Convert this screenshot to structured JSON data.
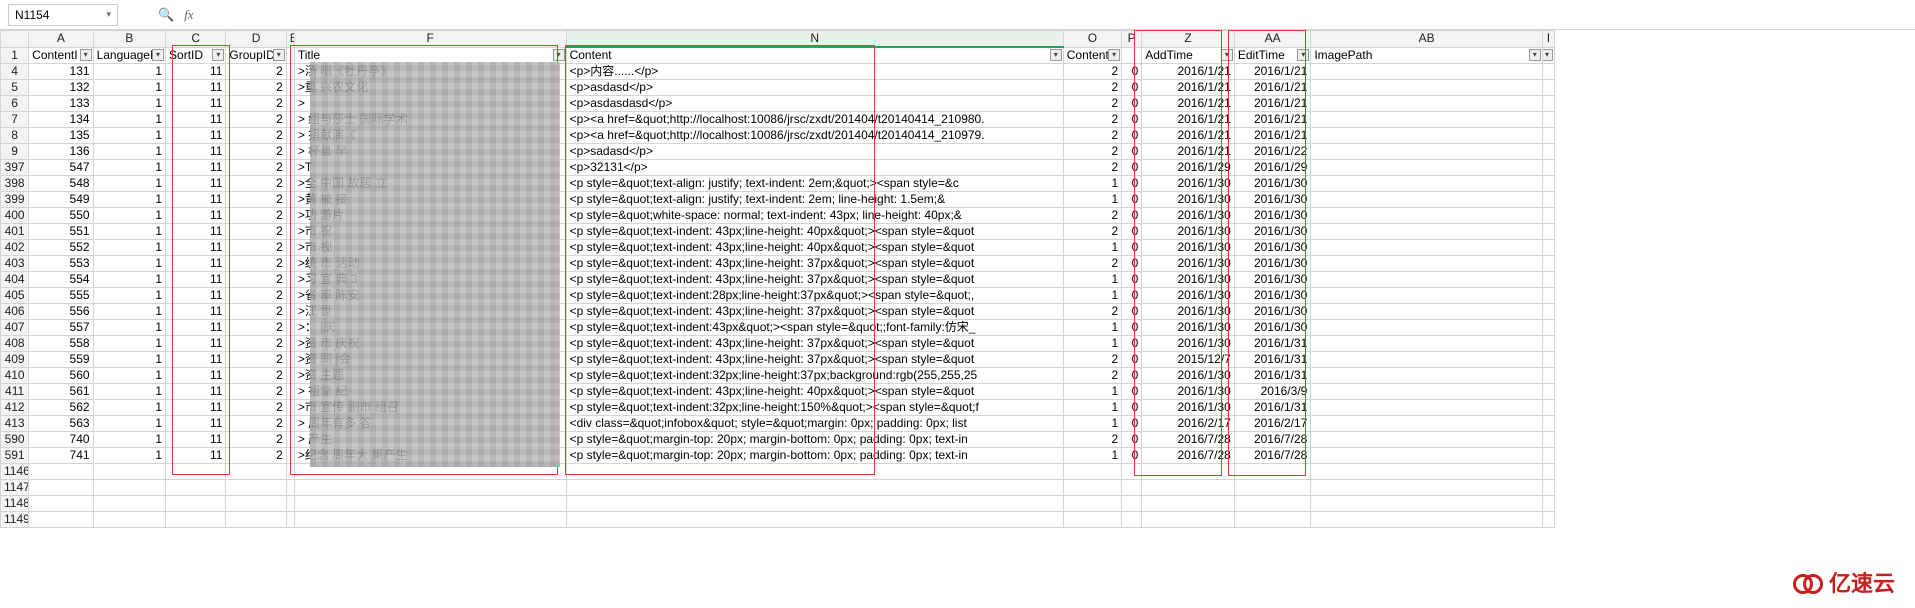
{
  "formula_bar": {
    "name_box": "N1154",
    "fx": "fx",
    "value": ""
  },
  "col_letters": [
    "A",
    "B",
    "C",
    "D",
    "E",
    "F",
    "N",
    "O",
    "P",
    "Z",
    "AA",
    "AB",
    "I"
  ],
  "headers": {
    "A": "ContentI",
    "B": "LanguageI",
    "C": "SortID",
    "D": "GroupID",
    "E": "",
    "F": "Title",
    "N": "Content",
    "O": "Content",
    "P": "",
    "Z": "AddTime",
    "AA": "EditTime",
    "AB": "ImagePath",
    "I": "I"
  },
  "rows": [
    {
      "r": 4,
      "A": 131,
      "B": 1,
      "C": 11,
      "D": 2,
      "F": ">汤           唱《牡丹亭》",
      "N": "<p>内容......</p>",
      "O": 2,
      "P": 0,
      "Z": "2016/1/21",
      "AA": "2016/1/21"
    },
    {
      "r": 5,
      "A": 132,
      "B": 1,
      "C": 11,
      "D": 2,
      "F": ">重             兴农文化",
      "N": "<p>asdasd</p>",
      "O": 2,
      "P": 0,
      "Z": "2016/1/21",
      "AA": "2016/1/21"
    },
    {
      "r": 6,
      "A": 133,
      "B": 1,
      "C": 11,
      "D": 2,
      "F": ">",
      "N": "<p>asdasdasd</p>",
      "O": 2,
      "P": 0,
      "Z": "2016/1/21",
      "AA": "2016/1/21"
    },
    {
      "r": 7,
      "A": 134,
      "B": 1,
      "C": 11,
      "D": 2,
      "F": ">   组与莎士     国际学术",
      "N": "<p><a href=&quot;http://localhost:10086/jrsc/zxdt/201404/t20140414_210980.",
      "O": 2,
      "P": 0,
      "Z": "2016/1/21",
      "AA": "2016/1/21"
    },
    {
      "r": 8,
      "A": 135,
      "B": 1,
      "C": 11,
      "D": 2,
      "F": ">      捐献演《",
      "N": "<p><a href=&quot;http://localhost:10086/jrsc/zxdt/201404/t20140414_210979.",
      "O": 2,
      "P": 0,
      "Z": "2016/1/21",
      "AA": "2016/1/21"
    },
    {
      "r": 9,
      "A": 136,
      "B": 1,
      "C": 11,
      "D": 2,
      "F": ">    杯县         早",
      "N": "<p>sadasd</p>",
      "O": 2,
      "P": 0,
      "Z": "2016/1/21",
      "AA": "2016/1/22"
    },
    {
      "r": 397,
      "A": 547,
      "B": 1,
      "C": 11,
      "D": 2,
      "F": ">T",
      "N": "<p>32131</p>",
      "O": 2,
      "P": 0,
      "Z": "2016/1/29",
      "AA": "2016/1/29"
    },
    {
      "r": 398,
      "A": 548,
      "B": 1,
      "C": 11,
      "D": 2,
      "F": ">全    中国         故居  立",
      "N": "<p style=&quot;text-align: justify; text-indent: 2em;&quot;><span style=&c",
      "O": 1,
      "P": 0,
      "Z": "2016/1/30",
      "AA": "2016/1/30"
    },
    {
      "r": 399,
      "A": 549,
      "B": 1,
      "C": 11,
      "D": 2,
      "F": ">黄     被              接",
      "N": "<p style=&quot;text-align: justify; text-indent: 2em; line-height: 1.5em;&",
      "O": 1,
      "P": 0,
      "Z": "2016/1/30",
      "AA": "2016/1/30"
    },
    {
      "r": 400,
      "A": 550,
      "B": 1,
      "C": 11,
      "D": 2,
      "F": ">功     游片",
      "N": "<p style=&quot;white-space: normal; text-indent: 43px; line-height: 40px;&",
      "O": 2,
      "P": 0,
      "Z": "2016/1/30",
      "AA": "2016/1/30"
    },
    {
      "r": 401,
      "A": 551,
      "B": 1,
      "C": 11,
      "D": 2,
      "F": ">市            祝",
      "N": "<p style=&quot;text-indent: 43px;line-height: 40px&quot;><span style=&quot",
      "O": 2,
      "P": 0,
      "Z": "2016/1/30",
      "AA": "2016/1/30"
    },
    {
      "r": 402,
      "A": 552,
      "B": 1,
      "C": 11,
      "D": 2,
      "F": ">市        视",
      "N": "<p style=&quot;text-indent: 43px;line-height: 40px&quot;><span style=&quot",
      "O": 1,
      "P": 0,
      "Z": "2016/1/30",
      "AA": "2016/1/30"
    },
    {
      "r": 403,
      "A": 553,
      "B": 1,
      "C": 11,
      "D": 2,
      "F": ">统 市        活动",
      "N": "<p style=&quot;text-indent: 43px;line-height: 37px&quot;><span style=&quot",
      "O": 2,
      "P": 0,
      "Z": "2016/1/30",
      "AA": "2016/1/30"
    },
    {
      "r": 404,
      "A": 554,
      "B": 1,
      "C": 11,
      "D": 2,
      "F": ">习     宣   典     3",
      "N": "<p style=&quot;text-indent: 43px;line-height: 37px&quot;><span style=&quot",
      "O": 1,
      "P": 0,
      "Z": "2016/1/30",
      "AA": "2016/1/30"
    },
    {
      "r": 405,
      "A": 555,
      "B": 1,
      "C": 11,
      "D": 2,
      "F": ">省      审      陈安",
      "N": "<p style=&quot;text-indent:28px;line-height:37px&quot;><span style=&quot;,",
      "O": 1,
      "P": 0,
      "Z": "2016/1/30",
      "AA": "2016/1/30"
    },
    {
      "r": 406,
      "A": 556,
      "B": 1,
      "C": 11,
      "D": 2,
      "F": ">江            世",
      "N": "<p style=&quot;text-indent: 43px;line-height: 37px&quot;><span style=&quot",
      "O": 2,
      "P": 0,
      "Z": "2016/1/30",
      "AA": "2016/1/30"
    },
    {
      "r": 407,
      "A": 557,
      "B": 1,
      "C": 11,
      "D": 2,
      "F": ">：             |庆",
      "N": "<p style=&quot;text-indent:43px&quot;><span style=&quot;;font-family:仿宋_",
      "O": 1,
      "P": 0,
      "Z": "2016/1/30",
      "AA": "2016/1/30"
    },
    {
      "r": 408,
      "A": 558,
      "B": 1,
      "C": 11,
      "D": 2,
      "F": ">资    市        庆祝",
      "N": "<p style=&quot;text-indent: 43px;line-height: 37px&quot;><span style=&quot",
      "O": 1,
      "P": 0,
      "Z": "2016/1/30",
      "AA": "2016/1/31"
    },
    {
      "r": 409,
      "A": 559,
      "B": 1,
      "C": 11,
      "D": 2,
      "F": ">资        同      |会",
      "N": "<p style=&quot;text-indent: 43px;line-height: 37px&quot;><span style=&quot",
      "O": 2,
      "P": 0,
      "Z": "2015/12/7",
      "AA": "2016/1/31"
    },
    {
      "r": 410,
      "A": 560,
      "B": 1,
      "C": 11,
      "D": 2,
      "F": ">资             主题",
      "N": "<p style=&quot;text-indent:32px;line-height:37px;background:rgb(255,255,25",
      "O": 2,
      "P": 0,
      "Z": "2016/1/30",
      "AA": "2016/1/31"
    },
    {
      "r": 411,
      "A": 561,
      "B": 1,
      "C": 11,
      "D": 2,
      "F": ">                祖堂    纪",
      "N": "<p style=&quot;text-indent: 43px;line-height: 40px&quot;><span style=&quot",
      "O": 1,
      "P": 0,
      "Z": "2016/1/30",
      "AA": "2016/3/9"
    },
    {
      "r": 412,
      "A": 562,
      "B": 1,
      "C": 11,
      "D": 2,
      "F": ">市    宣传       副市     组召",
      "N": "<p style=&quot;text-indent:32px;line-height:150%&quot;><span style=&quot;f",
      "O": 1,
      "P": 0,
      "Z": "2016/1/30",
      "AA": "2016/1/31"
    },
    {
      "r": 413,
      "A": 563,
      "B": 1,
      "C": 11,
      "D": 2,
      "F": ">           周年有多  答",
      "N": "<div class=&quot;infobox&quot; style=&quot;margin: 0px; padding: 0px; list",
      "O": 1,
      "P": 0,
      "Z": "2016/2/17",
      "AA": "2016/2/17"
    },
    {
      "r": 590,
      "A": 740,
      "B": 1,
      "C": 11,
      "D": 2,
      "F": ">               产生",
      "N": "<p style=&quot;margin-top: 20px; margin-bottom: 0px; padding: 0px; text-in",
      "O": 2,
      "P": 0,
      "Z": "2016/7/28",
      "AA": "2016/7/28"
    },
    {
      "r": 591,
      "A": 741,
      "B": 1,
      "C": 11,
      "D": 2,
      "F": ">纪念      周年大     果产生",
      "N": "<p style=&quot;margin-top: 20px; margin-bottom: 0px; padding: 0px; text-in",
      "O": 1,
      "P": 0,
      "Z": "2016/7/28",
      "AA": "2016/7/28"
    },
    {
      "r": 1146
    },
    {
      "r": 1147
    },
    {
      "r": 1148
    },
    {
      "r": 1149
    }
  ],
  "watermark": "亿速云"
}
